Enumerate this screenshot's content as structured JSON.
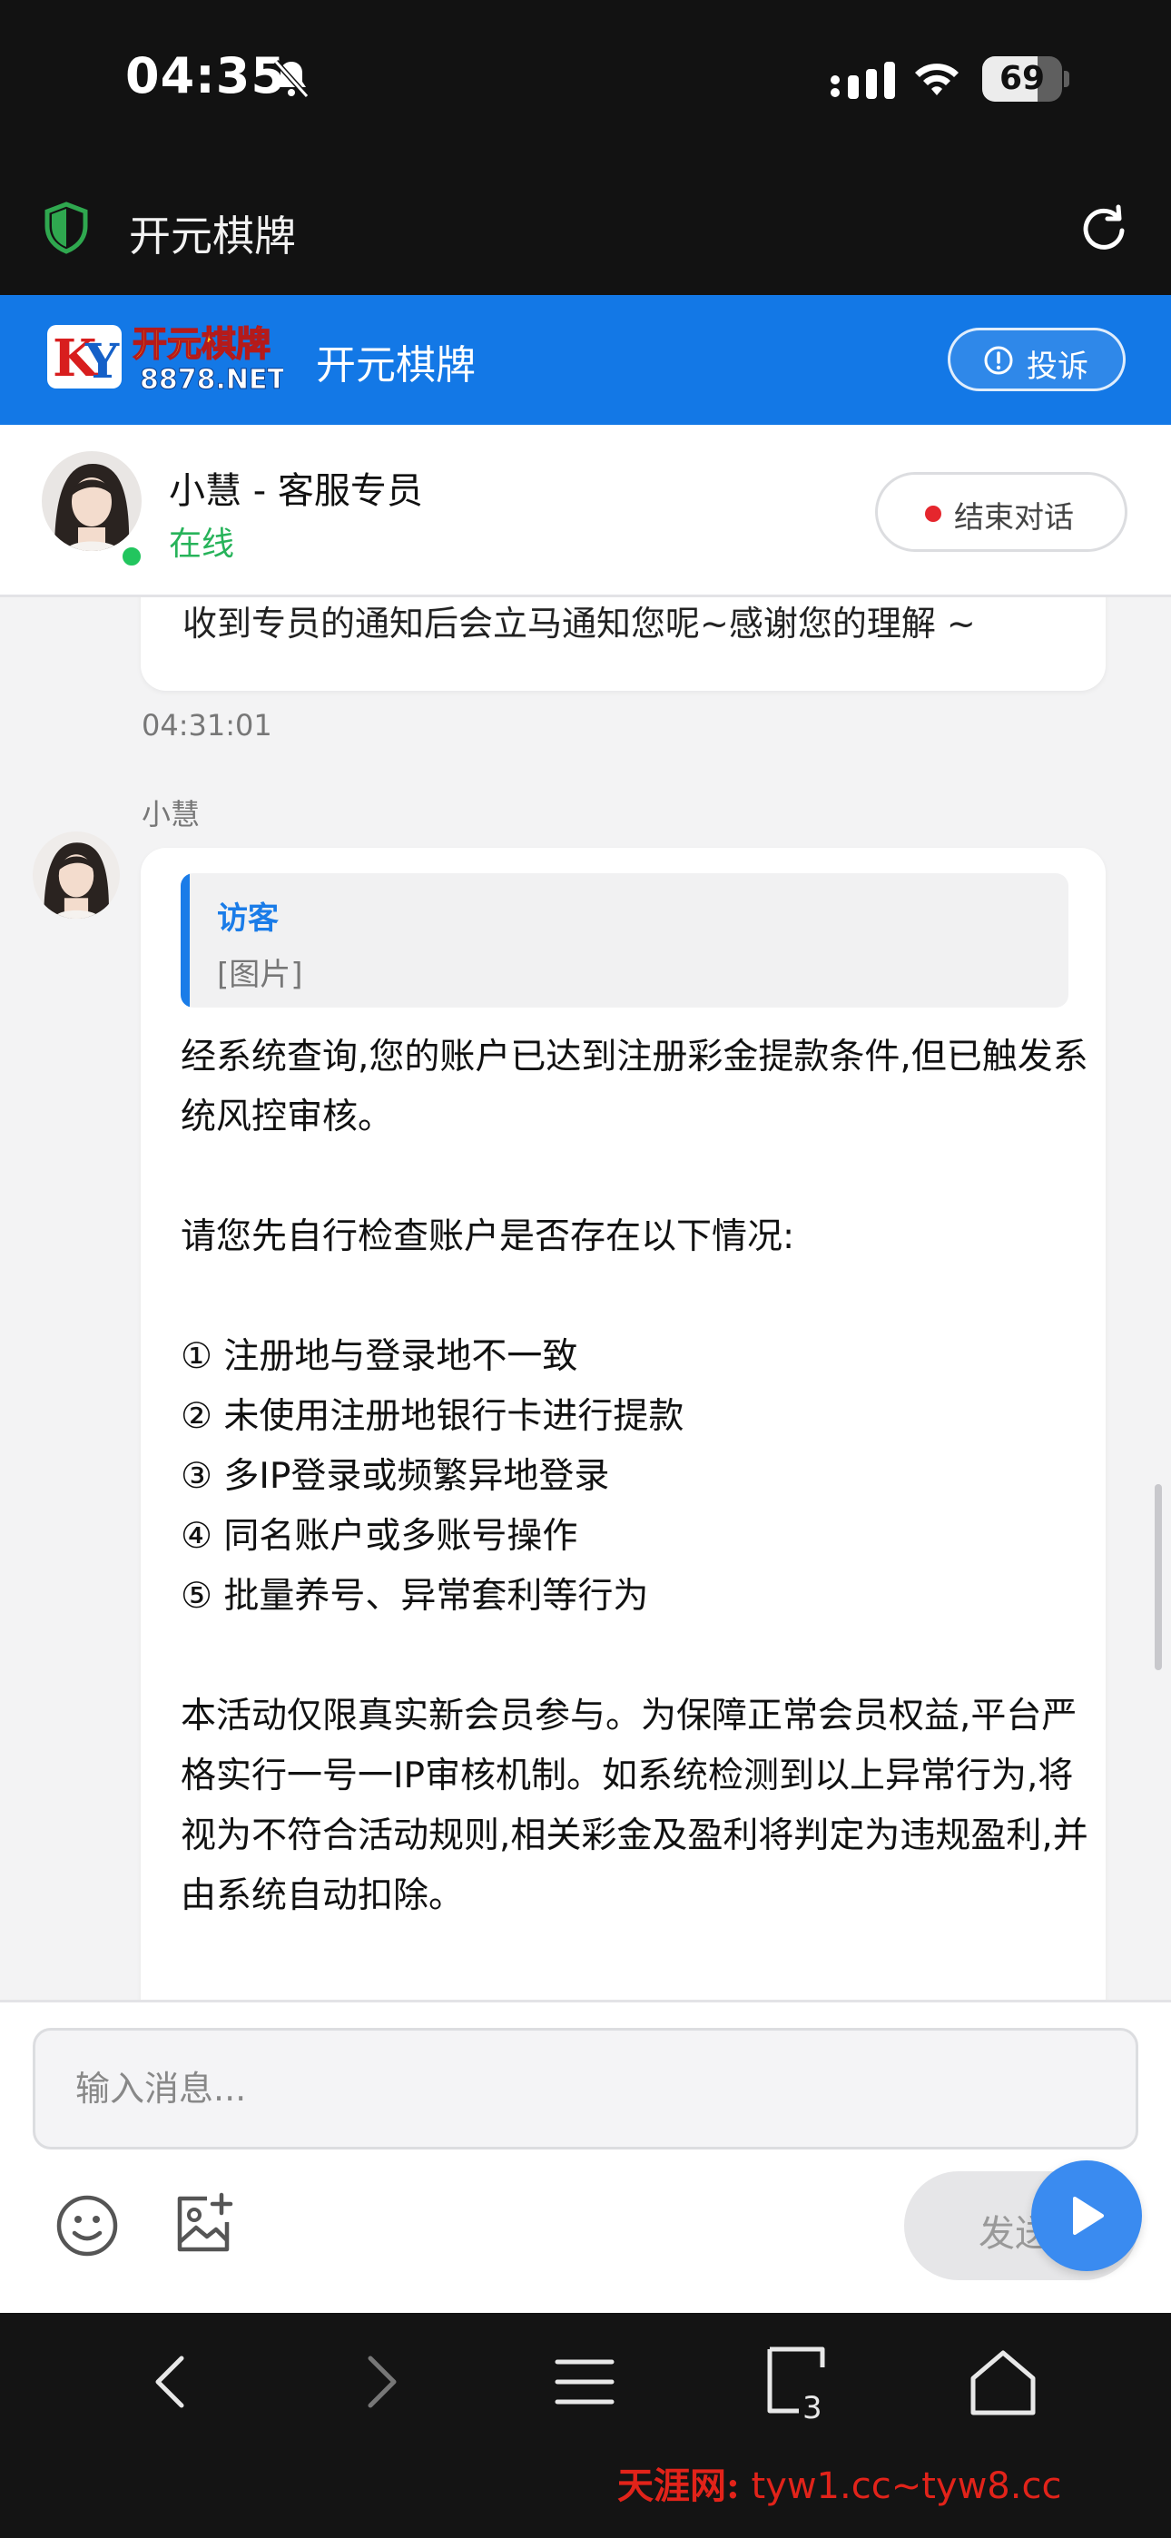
{
  "status_bar": {
    "time": "04:35",
    "battery": "69",
    "battery_level": 0.69
  },
  "browser": {
    "page_title": "开元棋牌",
    "open_tabs": "3"
  },
  "site": {
    "logo_text_top": "开元棋牌",
    "logo_text_bottom": "8878.NET",
    "logo_letters": "KY",
    "name": "开元棋牌",
    "complain_label": "投诉",
    "brand_color": "#1378e6"
  },
  "agent": {
    "name": "小慧 - 客服专员",
    "status": "在线",
    "end_chat_label": "结束对话"
  },
  "chat": {
    "previous_message": "收到专员的通知后会立马通知您呢~感谢您的理解 ~",
    "timestamp": "04:31:01",
    "sender": "小慧",
    "quote": {
      "author": "访客",
      "content": "[图片]"
    },
    "paragraphs": [
      "经系统查询,您的账户已达到注册彩金提款条件,但已触发系统风控审核。",
      "请您先自行检查账户是否存在以下情况:"
    ],
    "conditions": [
      "① 注册地与登录地不一致",
      "② 未使用注册地银行卡进行提款",
      "③ 多IP登录或频繁异地登录",
      "④ 同名账户或多账号操作",
      "⑤ 批量养号、异常套利等行为"
    ],
    "closing": "本活动仅限真实新会员参与。为保障正常会员权益,平台严格实行一号一IP审核机制。如系统检测到以上异常行为,将视为不符合活动规则,相关彩金及盈利将判定为违规盈利,并由系统自动扣除。"
  },
  "composer": {
    "placeholder": "输入消息...",
    "send_label": "发送"
  },
  "watermark": {
    "brand": "天涯网:",
    "url": "tyw1.cc~tyw8.cc"
  }
}
